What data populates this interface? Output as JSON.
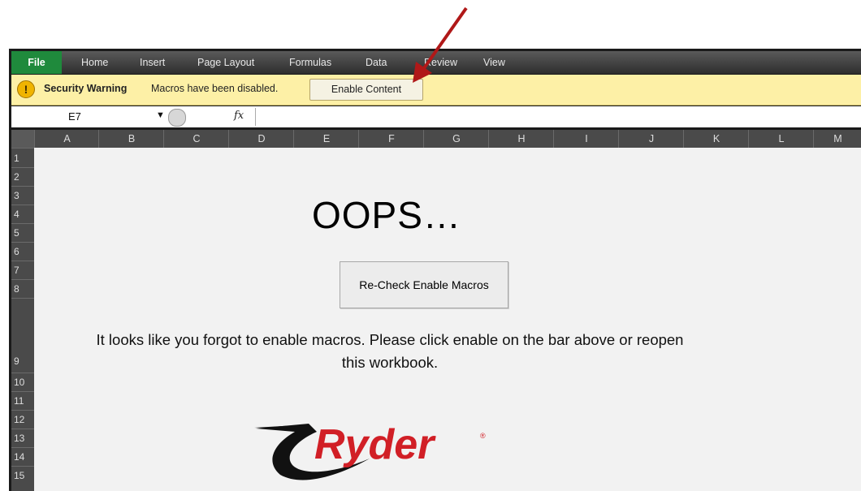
{
  "ribbon": {
    "tabs": [
      "File",
      "Home",
      "Insert",
      "Page Layout",
      "Formulas",
      "Data",
      "Review",
      "View"
    ]
  },
  "security_bar": {
    "title": "Security Warning",
    "message": "Macros have been disabled.",
    "button": "Enable Content"
  },
  "formula_bar": {
    "cell_ref": "E7",
    "fx": "fx",
    "value": ""
  },
  "columns": [
    "A",
    "B",
    "C",
    "D",
    "E",
    "F",
    "G",
    "H",
    "I",
    "J",
    "K",
    "L",
    "M"
  ],
  "rows": [
    "1",
    "2",
    "3",
    "4",
    "5",
    "6",
    "7",
    "8",
    "9",
    "10",
    "11",
    "12",
    "13",
    "14",
    "15"
  ],
  "sheet": {
    "heading": "OOPS…",
    "button": "Re-Check Enable Macros",
    "message_line1": "It looks like you forgot to enable macros.  Please click enable on the bar above or reopen",
    "message_line2": "this workbook.",
    "logo_text": "Ryder"
  },
  "colors": {
    "file_tab": "#1f8a3c",
    "security_bar": "#fdf0a6",
    "arrow": "#b01818",
    "logo_red": "#d11f26"
  }
}
